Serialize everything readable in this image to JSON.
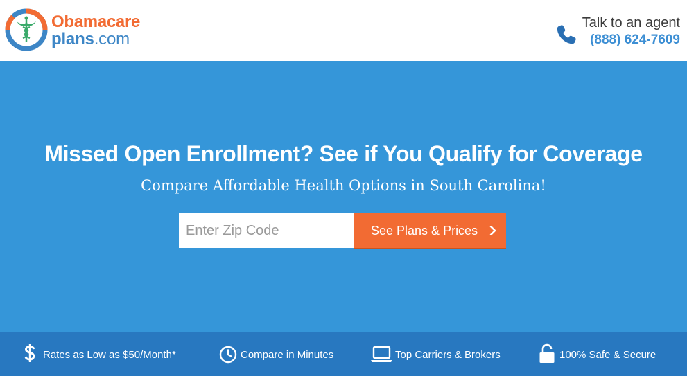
{
  "header": {
    "logo": {
      "line1": "Obamacare",
      "line2_main": "plans",
      "line2_suffix": ".com"
    },
    "agent": {
      "label": "Talk to an agent",
      "phone": "(888) 624-7609"
    }
  },
  "hero": {
    "title": "Missed Open Enrollment? See if You Qualify for Coverage",
    "subtitle": "Compare Affordable Health Options in South Carolina!",
    "zip_placeholder": "Enter Zip Code",
    "zip_value": "",
    "cta_label": "See Plans & Prices"
  },
  "features": [
    {
      "icon": "dollar-icon",
      "prefix": "Rates as Low as ",
      "link": "$50/Month",
      "suffix": "*"
    },
    {
      "icon": "clock-icon",
      "text": "Compare in Minutes"
    },
    {
      "icon": "laptop-icon",
      "text": "Top Carriers & Brokers"
    },
    {
      "icon": "lock-icon",
      "text": "100% Safe & Secure"
    }
  ],
  "colors": {
    "brand_orange": "#f26b33",
    "brand_blue": "#3d86c6",
    "hero_background": "#3596d9",
    "features_background": "#2878c0",
    "phone_text": "#3d8fd4"
  }
}
